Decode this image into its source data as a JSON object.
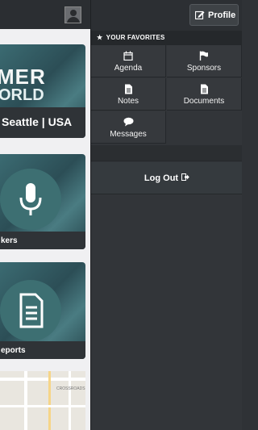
{
  "left_app": {
    "card1_banner_line1": "MER",
    "card1_banner_line2": "ORLD",
    "card1_caption": "Seattle | USA",
    "card2_caption": "kers",
    "card3_caption": "eports",
    "map_label": "CROSSROADS"
  },
  "drawer": {
    "profile_label": "Profile",
    "favorites_header": "YOUR FAVORITES",
    "items": [
      {
        "label": "Agenda",
        "icon": "calendar-icon"
      },
      {
        "label": "Sponsors",
        "icon": "flag-icon"
      },
      {
        "label": "Notes",
        "icon": "document-icon"
      },
      {
        "label": "Documents",
        "icon": "document-icon"
      },
      {
        "label": "Messages",
        "icon": "chat-bubble-icon"
      }
    ],
    "logout_label": "Log Out"
  },
  "colors": {
    "drawer_bg": "#323539",
    "tile_bg": "#36393d",
    "card_teal": "#3d6f72"
  }
}
